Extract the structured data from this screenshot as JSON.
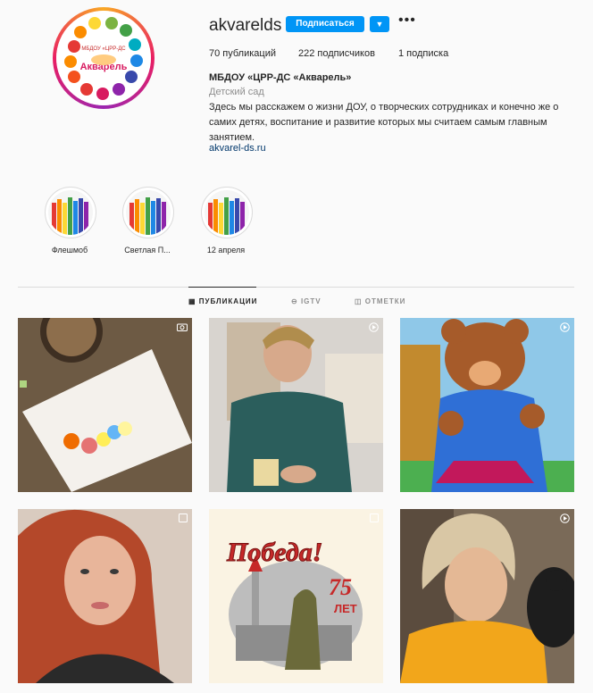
{
  "profile": {
    "username": "akvarelds",
    "follow_label": "Подписаться",
    "stats": {
      "posts": "70 публикаций",
      "followers": "222 подписчиков",
      "following": "1 подписка"
    },
    "full_name": "МБДОУ «ЦРР-ДС «Акварель»",
    "category": "Детский сад",
    "bio": "Здесь мы расскажем о жизни ДОУ, о творческих сотрудниках и конечно же о самих детях, воспитание и развитие которых мы считаем самым главным занятием.",
    "link": "akvarel-ds.ru",
    "logo_text_top": "МБДОУ «ЦРР-ДС",
    "logo_text_main": "Акварель"
  },
  "highlights": [
    {
      "label": "Флешмоб"
    },
    {
      "label": "Светлая П..."
    },
    {
      "label": "12 апреля"
    }
  ],
  "tabs": [
    {
      "label": "ПУБЛИКАЦИИ"
    },
    {
      "label": "IGTV"
    },
    {
      "label": "ОТМЕТКИ"
    }
  ],
  "posts": [
    {
      "badge": "camera-icon"
    },
    {
      "badge": "clip-icon"
    },
    {
      "badge": "clip-icon"
    },
    {
      "badge": "gallery-icon"
    },
    {
      "badge": "gallery-icon",
      "title": "Победа!",
      "subtitle": "75",
      "subtitle2": "ЛЕТ"
    },
    {
      "badge": "clip-icon"
    }
  ],
  "colors": {
    "accent": "#0095f6",
    "text": "#262626",
    "muted": "#8e8e8e",
    "link": "#00376b"
  }
}
